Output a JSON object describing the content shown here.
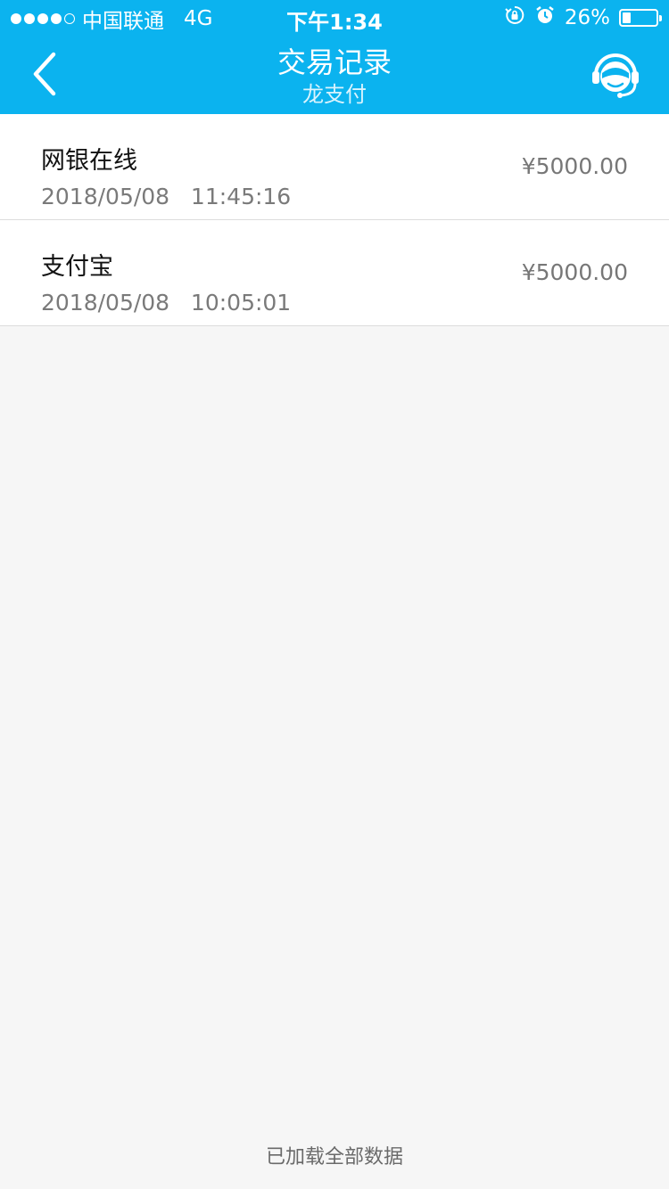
{
  "status_bar": {
    "carrier": "中国联通",
    "network": "4G",
    "time": "下午1:34",
    "battery": "26%",
    "battery_level": 0.26,
    "signal_strength": 4,
    "signal_max": 5
  },
  "nav": {
    "title": "交易记录",
    "subtitle": "龙支付",
    "back_icon": "chevron-left-icon",
    "service_icon": "customer-service-icon"
  },
  "transactions": [
    {
      "title": "网银在线",
      "time": "2018/05/08   11:45:16",
      "amount": "¥5000.00"
    },
    {
      "title": "支付宝",
      "time": "2018/05/08   10:05:01",
      "amount": "¥5000.00"
    }
  ],
  "footer": {
    "text": "已加载全部数据"
  },
  "colors": {
    "header": "#0bb3ef",
    "background": "#f6f6f6"
  }
}
